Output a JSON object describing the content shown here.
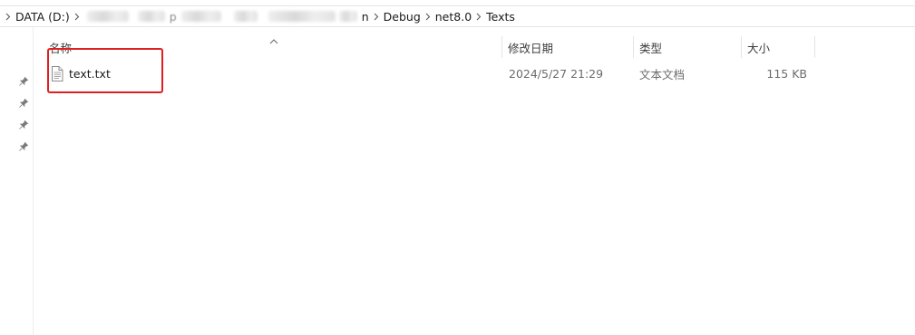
{
  "breadcrumb": {
    "items": [
      {
        "label": "DATA (D:)"
      },
      {
        "label": ""
      },
      {
        "label": "n"
      },
      {
        "label": "Debug"
      },
      {
        "label": "net8.0"
      },
      {
        "label": "Texts"
      }
    ],
    "redacted_fragments": [
      "p"
    ]
  },
  "columns": {
    "name": "名称",
    "modified": "修改日期",
    "type": "类型",
    "size": "大小",
    "sort": "ascending"
  },
  "files": [
    {
      "name": "text.txt",
      "modified": "2024/5/27 21:29",
      "type": "文本文档",
      "size": "115 KB",
      "icon": "text-file-icon"
    }
  ],
  "nav_pane": {
    "pins": [
      "pin-icon",
      "pin-icon",
      "pin-icon",
      "pin-icon"
    ]
  },
  "annotation": {
    "highlight_color": "#e02020",
    "target": "text.txt"
  }
}
